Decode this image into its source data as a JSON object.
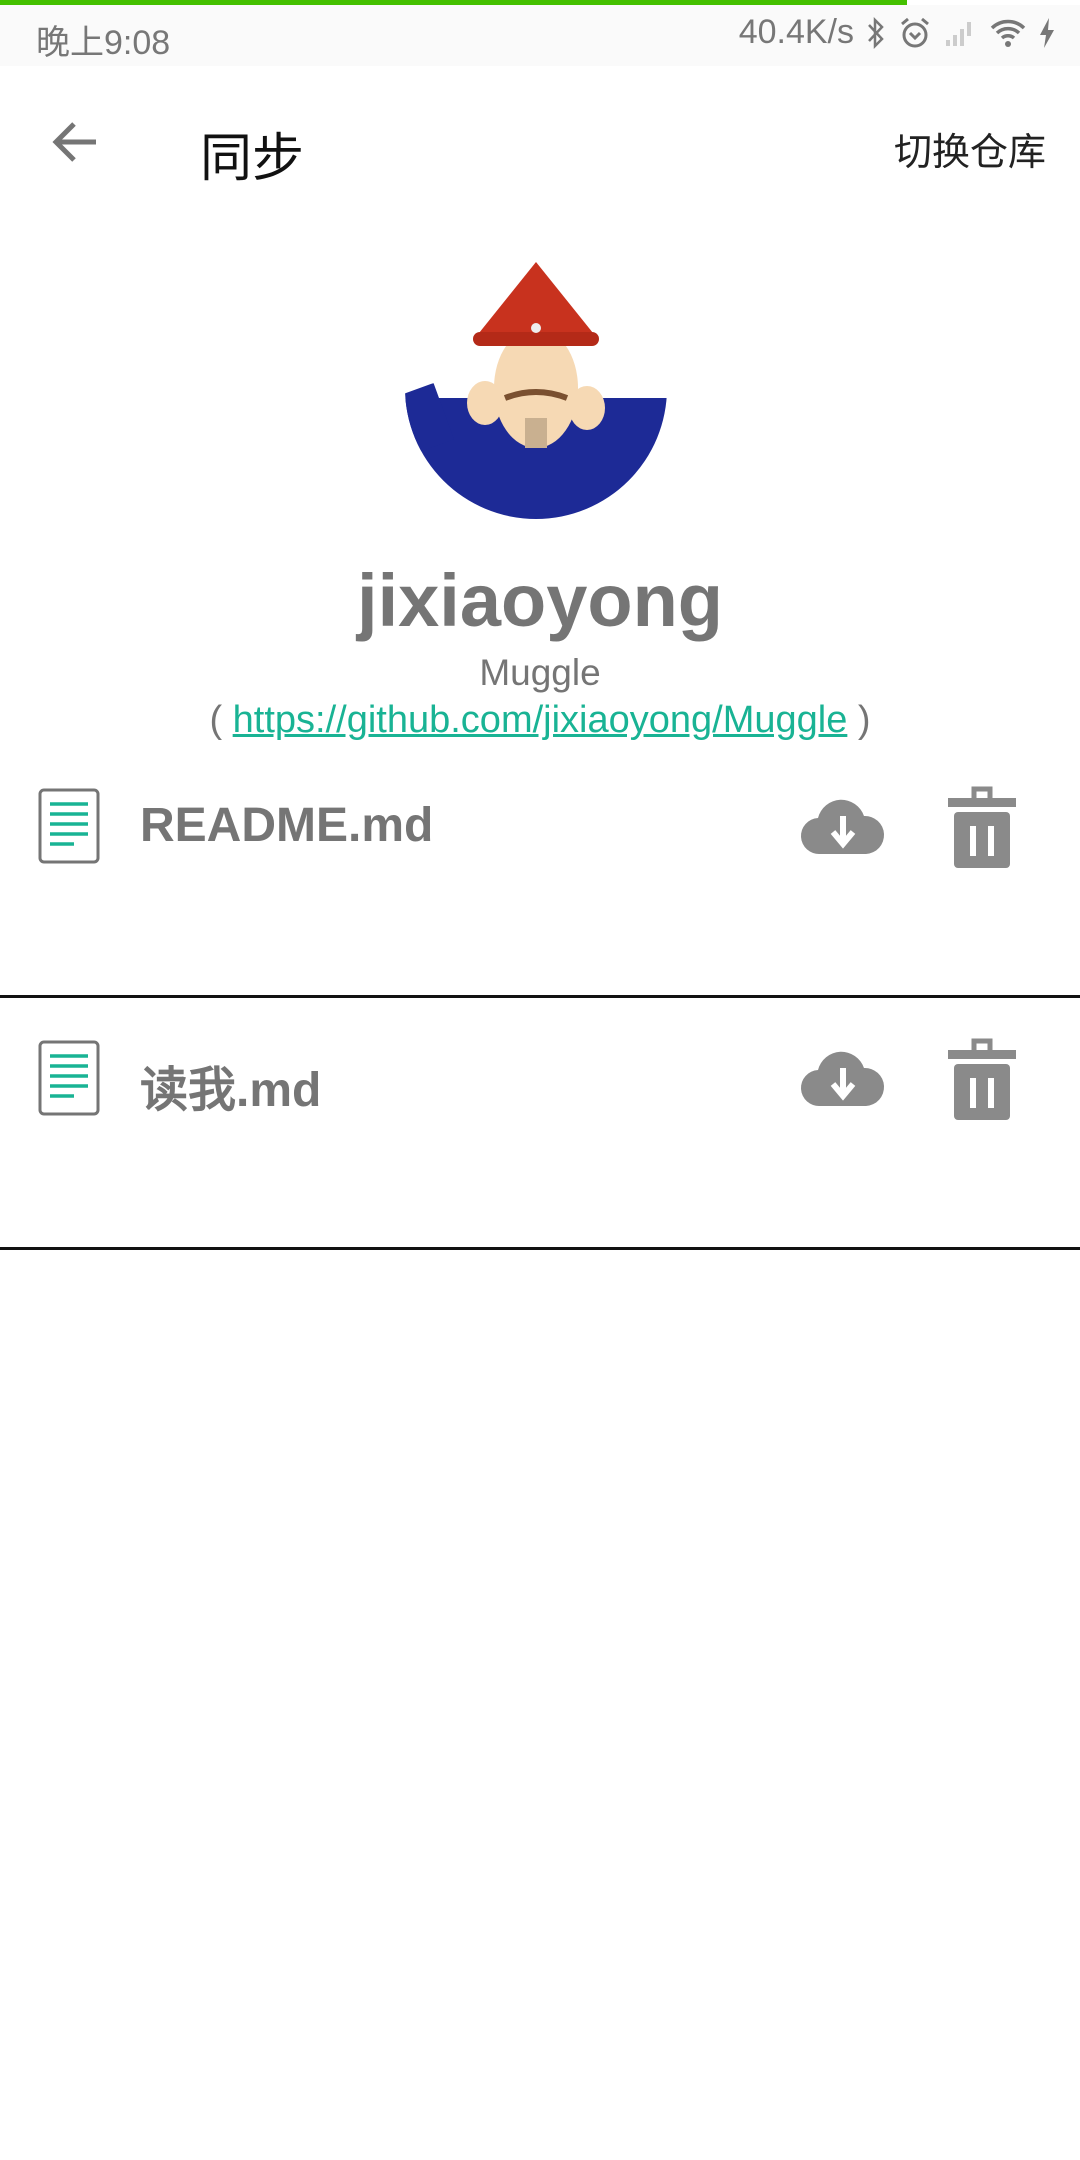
{
  "status_bar": {
    "time": "晚上9:08",
    "speed": "40.4K/s",
    "load_progress_percent": 84
  },
  "toolbar": {
    "title": "同步",
    "action": "切换仓库"
  },
  "profile": {
    "name": "jixiaoyong",
    "repo": "Muggle",
    "paren_open": "(",
    "link": "https://github.com/jixiaoyong/Muggle",
    "paren_close": ")"
  },
  "files": [
    {
      "name": "README.md"
    },
    {
      "name": "读我.md"
    }
  ],
  "colors": {
    "accent": "#19b394",
    "icon_gray": "#8a8a8a",
    "progress": "#44c000"
  }
}
